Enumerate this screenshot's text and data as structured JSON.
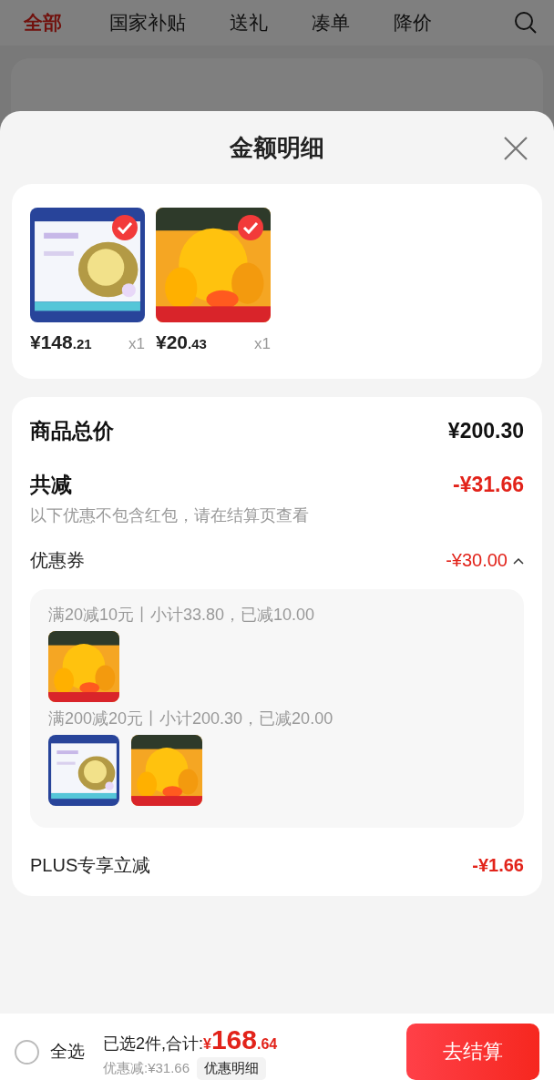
{
  "background_page": {
    "tabs": [
      {
        "label": "全部",
        "selected": true
      },
      {
        "label": "国家补贴",
        "selected": false
      },
      {
        "label": "送礼",
        "selected": false
      },
      {
        "label": "凑单",
        "selected": false
      },
      {
        "label": "降价",
        "selected": false
      }
    ]
  },
  "sheet": {
    "title": "金额明细",
    "products": [
      {
        "kind": "durian",
        "selected": true,
        "price_main": "¥148",
        "price_decimals": ".21",
        "quantity": "x1"
      },
      {
        "kind": "mango",
        "selected": true,
        "price_main": "¥20",
        "price_decimals": ".43",
        "quantity": "x1"
      }
    ],
    "total": {
      "label": "商品总价",
      "value": "¥200.30"
    },
    "reduction": {
      "label": "共减",
      "value": "-¥31.66",
      "note": "以下优惠不包含红包，请在结算页查看"
    },
    "coupon": {
      "label": "优惠券",
      "value": "-¥30.00",
      "expanded": true,
      "groups": [
        {
          "rule": "满20减10元丨小计33.80，已减10.00",
          "items": [
            {
              "kind": "mango"
            }
          ]
        },
        {
          "rule": "满200减20元丨小计200.30，已减20.00",
          "items": [
            {
              "kind": "durian"
            },
            {
              "kind": "mango"
            }
          ]
        }
      ]
    },
    "plus": {
      "label": "PLUS专享立减",
      "value": "-¥1.66"
    }
  },
  "bottom_bar": {
    "select_all": {
      "label": "全选",
      "checked": false
    },
    "summary": "已选2件,合计:",
    "currency": "¥",
    "total_main": "168",
    "total_decimals": ".64",
    "discount": "优惠减:¥31.66",
    "details_button": "优惠明细",
    "checkout_button": "去结算"
  }
}
